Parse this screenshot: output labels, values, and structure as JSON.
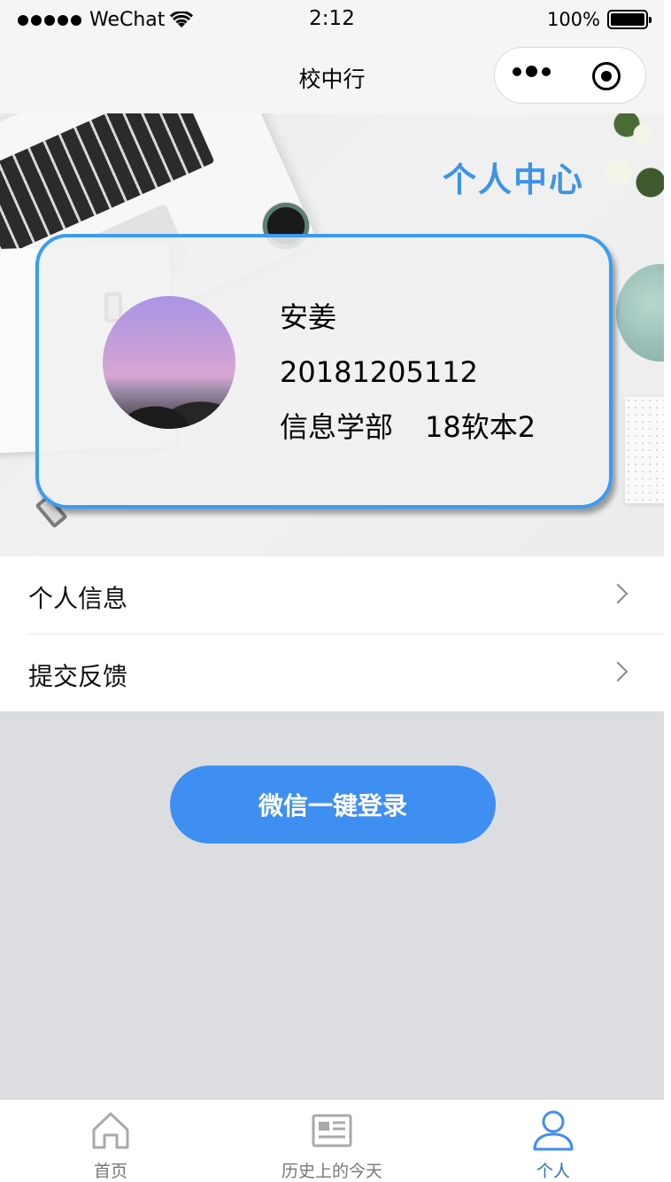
{
  "status_bar": {
    "carrier": "WeChat",
    "time": "2:12",
    "battery": "100%"
  },
  "nav": {
    "title": "校中行"
  },
  "banner": {
    "title": "个人中心"
  },
  "profile": {
    "name": "安姜",
    "student_id": "20181205112",
    "department": "信息学部",
    "class": "18软本2"
  },
  "menu": {
    "items": [
      {
        "label": "个人信息"
      },
      {
        "label": "提交反馈"
      }
    ]
  },
  "login_button": {
    "label": "微信一键登录"
  },
  "tab_bar": {
    "tabs": [
      {
        "label": "首页",
        "icon": "home-icon"
      },
      {
        "label": "历史上的今天",
        "icon": "newspaper-icon"
      },
      {
        "label": "个人",
        "icon": "user-icon",
        "active": true
      }
    ]
  },
  "colors": {
    "accent": "#3f8ef2",
    "card_border": "#3b9bf2",
    "banner_title": "#3d94e6",
    "page_background": "#dcdde0"
  }
}
